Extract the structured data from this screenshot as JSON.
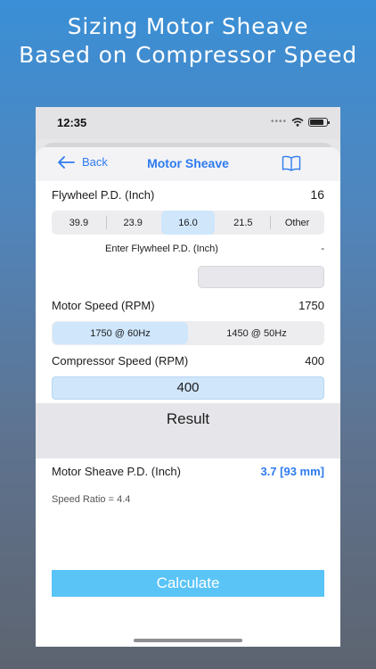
{
  "headline": {
    "line1": "Sizing Motor Sheave",
    "line2": "Based on Compressor Speed"
  },
  "status": {
    "time": "12:35"
  },
  "nav": {
    "back_label": "Back",
    "title": "Motor Sheave",
    "icon": "book-icon"
  },
  "flywheel": {
    "label": "Flywheel P.D. (Inch)",
    "value": "16",
    "options": [
      "39.9",
      "23.9",
      "16.0",
      "21.5",
      "Other"
    ],
    "selected": "16.0",
    "enter_label": "Enter Flywheel P.D. (Inch)",
    "enter_value": "-",
    "input_value": ""
  },
  "motor": {
    "label": "Motor Speed (RPM)",
    "value": "1750",
    "options": [
      "1750 @ 60Hz",
      "1450 @ 50Hz"
    ],
    "selected": "1750 @ 60Hz"
  },
  "compressor": {
    "label": "Compressor Speed (RPM)",
    "value": "400",
    "input_value": "400"
  },
  "result": {
    "title": "Result",
    "sheave_label": "Motor Sheave P.D. (Inch)",
    "sheave_value": "3.7 [93 mm]",
    "ratio": "Speed Ratio = 4.4"
  },
  "calculate_label": "Calculate",
  "colors": {
    "accent": "#2e7bf0",
    "button": "#5ac4f7",
    "selected_segment": "#cfe6fb"
  }
}
